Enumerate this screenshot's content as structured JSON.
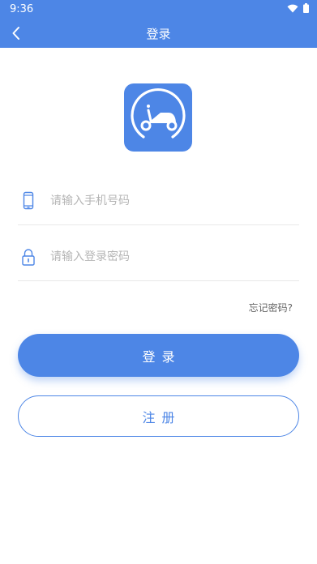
{
  "status_bar": {
    "time": "9:36",
    "wifi_icon": "wifi-icon",
    "battery_icon": "battery-icon"
  },
  "nav": {
    "back_icon": "chevron-left-icon",
    "title": "登录"
  },
  "logo": {
    "icon": "scooter-icon"
  },
  "form": {
    "phone": {
      "icon": "phone-icon",
      "value": "",
      "placeholder": "请输入手机号码"
    },
    "password": {
      "icon": "lock-icon",
      "value": "",
      "placeholder": "请输入登录密码"
    }
  },
  "forgot_password_label": "忘记密码?",
  "login_button_label": "登录",
  "register_button_label": "注册",
  "colors": {
    "primary": "#4d86e6",
    "background": "#ffffff",
    "placeholder": "#b5b5b5",
    "divider": "#e8e8e8"
  }
}
